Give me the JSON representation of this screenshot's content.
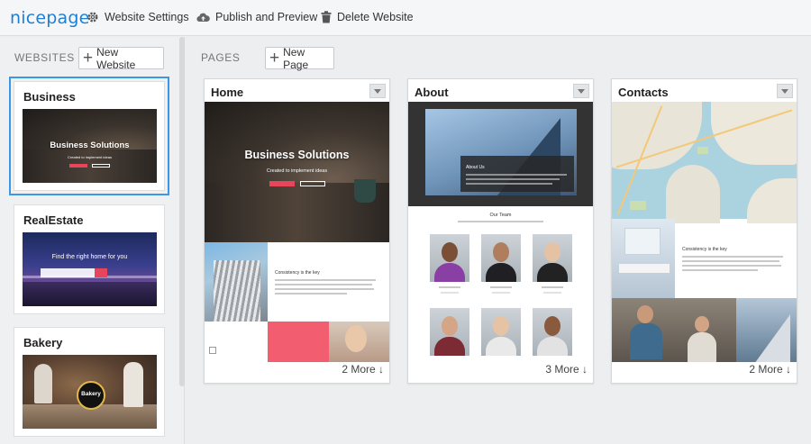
{
  "app": {
    "logo": "nicepage"
  },
  "toolbar": {
    "settings_label": "Website Settings",
    "publish_label": "Publish and Preview",
    "delete_label": "Delete Website"
  },
  "sidebar": {
    "section_label": "WEBSITES",
    "new_button": "New Website",
    "websites": [
      {
        "title": "Business",
        "thumb_title": "Business Solutions",
        "thumb_sub": "Created to implement ideas"
      },
      {
        "title": "RealEstate",
        "thumb_title": "Find the right home for you"
      },
      {
        "title": "Bakery",
        "thumb_badge": "Bakery"
      }
    ]
  },
  "pages": {
    "section_label": "PAGES",
    "new_button": "New Page",
    "items": [
      {
        "title": "Home",
        "hero_title": "Business Solutions",
        "hero_sub": "Created to implement ideas",
        "block_heading": "Consistency is the key",
        "more": "2 More ↓"
      },
      {
        "title": "About",
        "hero_heading": "About Us",
        "team_heading": "Our Team",
        "more": "3 More ↓"
      },
      {
        "title": "Contacts",
        "block_heading": "Consistency is the key",
        "more": "2 More ↓"
      }
    ]
  }
}
